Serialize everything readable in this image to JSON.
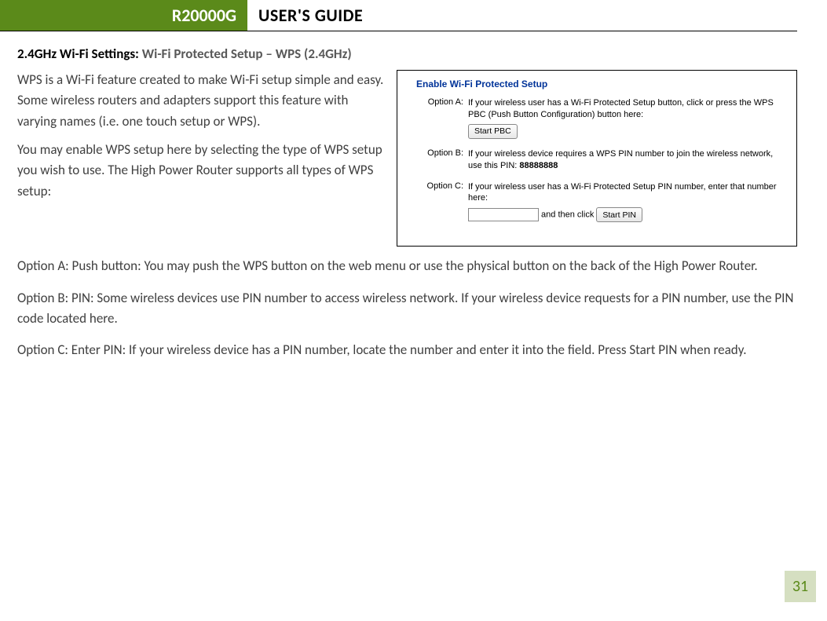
{
  "header": {
    "model": "R20000G",
    "title": "USER'S GUIDE"
  },
  "section": {
    "prefix": "2.4GHz Wi-Fi Settings: ",
    "suffix": "Wi-Fi Protected Setup – WPS (2.4GHz)"
  },
  "intro": {
    "p1": "WPS is a Wi-Fi feature created to make Wi-Fi setup simple and easy.  Some wireless routers and adapters support this feature with varying names (i.e. one touch setup or WPS).",
    "p2": "You may enable WPS setup here by selecting the type of WPS setup you wish to use.  The High Power Router supports all types of WPS setup:"
  },
  "screenshot": {
    "title": "Enable Wi-Fi Protected Setup",
    "optionA": {
      "label": "Option A:",
      "text": "If your wireless user has a Wi-Fi Protected Setup button, click or press the WPS PBC (Push Button Configuration) button here:",
      "button": "Start PBC"
    },
    "optionB": {
      "label": "Option B:",
      "text": "If your wireless device requires a WPS PIN number to join the wireless network, use this PIN: ",
      "pin": "88888888"
    },
    "optionC": {
      "label": "Option C:",
      "text": "If your wireless user has a Wi-Fi Protected Setup PIN number, enter that number here:",
      "mid": " and then click ",
      "button": "Start PIN"
    }
  },
  "body": {
    "a": "Option A: Push button: You may push the WPS button on the web menu or use the physical button on the back of the High Power Router.",
    "b": "Option B: PIN: Some wireless devices use PIN number to access wireless network.  If your wireless device requests for a PIN number, use the PIN code located here.",
    "c": "Option C: Enter PIN: If your wireless device has a PIN number, locate the number and enter it into the field.  Press Start PIN when ready."
  },
  "page": "31"
}
